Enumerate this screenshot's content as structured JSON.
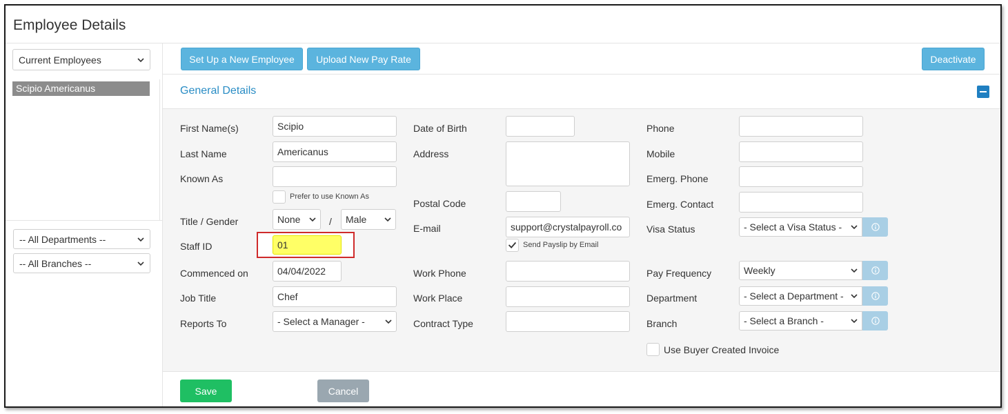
{
  "page": {
    "title": "Employee Details"
  },
  "left_panel": {
    "employee_filter": "Current Employees",
    "employees": [
      "Scipio Americanus"
    ],
    "department_filter": "-- All Departments --",
    "branch_filter": "-- All Branches --"
  },
  "toolbar": {
    "setup_label": "Set Up a New Employee",
    "upload_label": "Upload New Pay Rate",
    "deactivate_label": "Deactivate"
  },
  "section": {
    "title": "General Details"
  },
  "form": {
    "first_name": {
      "label": "First Name(s)",
      "value": "Scipio"
    },
    "last_name": {
      "label": "Last Name",
      "value": "Americanus"
    },
    "known_as": {
      "label": "Known As",
      "value": "",
      "prefer_label": "Prefer to use Known As"
    },
    "title_gender": {
      "label": "Title / Gender",
      "title": "None",
      "separator": "/",
      "gender": "Male"
    },
    "staff_id": {
      "label": "Staff ID",
      "value": "01"
    },
    "commenced": {
      "label": "Commenced on",
      "value": "04/04/2022"
    },
    "job_title": {
      "label": "Job Title",
      "value": "Chef"
    },
    "reports_to": {
      "label": "Reports To",
      "value": "- Select a Manager -"
    },
    "dob": {
      "label": "Date of Birth",
      "value": ""
    },
    "address": {
      "label": "Address",
      "value": ""
    },
    "postal_code": {
      "label": "Postal Code",
      "value": ""
    },
    "email": {
      "label": "E-mail",
      "value": "support@crystalpayroll.co",
      "send_label": "Send Payslip by Email"
    },
    "work_phone": {
      "label": "Work Phone",
      "value": ""
    },
    "work_place": {
      "label": "Work Place",
      "value": ""
    },
    "contract_type": {
      "label": "Contract Type",
      "value": ""
    },
    "phone": {
      "label": "Phone",
      "value": ""
    },
    "mobile": {
      "label": "Mobile",
      "value": ""
    },
    "emerg_phone": {
      "label": "Emerg. Phone",
      "value": ""
    },
    "emerg_contact": {
      "label": "Emerg. Contact",
      "value": ""
    },
    "visa_status": {
      "label": "Visa Status",
      "value": "- Select a Visa Status -"
    },
    "pay_frequency": {
      "label": "Pay Frequency",
      "value": "Weekly"
    },
    "department": {
      "label": "Department",
      "value": "- Select a Department -"
    },
    "branch": {
      "label": "Branch",
      "value": "- Select a Branch -"
    },
    "buyer_invoice_label": "Use Buyer Created Invoice"
  },
  "actions": {
    "save_label": "Save",
    "cancel_label": "Cancel"
  },
  "colors": {
    "accent_blue": "#5bb4de",
    "title_blue": "#2a8dc5",
    "save_green": "#1fbf63",
    "cancel_grey": "#9aa7b0",
    "highlight_yellow": "#ffff66",
    "highlight_border": "#cf2a2a"
  },
  "icons": [
    "chevron-down-icon",
    "collapse-icon",
    "info-icon",
    "checkmark-icon"
  ]
}
